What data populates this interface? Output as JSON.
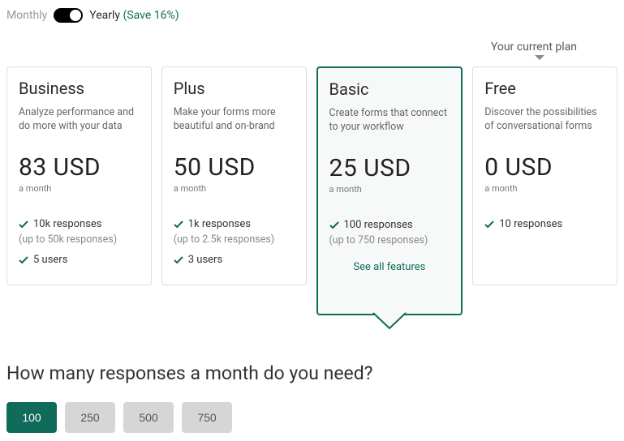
{
  "billing": {
    "monthly_label": "Monthly",
    "yearly_label": "Yearly",
    "save_label": "(Save 16%)"
  },
  "current_plan_label": "Your current plan",
  "plans": [
    {
      "name": "Business",
      "desc": "Analyze performance and do more with your data",
      "price": "83 USD",
      "period": "a month",
      "feat1": "10k responses",
      "feat1_sub": "(up to 50k responses)",
      "feat2": "5 users"
    },
    {
      "name": "Plus",
      "desc": "Make your forms more beautiful and on-brand",
      "price": "50 USD",
      "period": "a month",
      "feat1": "1k responses",
      "feat1_sub": "(up to 2.5k responses)",
      "feat2": "3 users"
    },
    {
      "name": "Basic",
      "desc": "Create forms that connect to your workflow",
      "price": "25 USD",
      "period": "a month",
      "feat1": "100 responses",
      "feat1_sub": "(up to 750 responses)",
      "see_all": "See all features"
    },
    {
      "name": "Free",
      "desc": "Discover the possibilities of conversational forms",
      "price": "0 USD",
      "period": "a month",
      "feat1": "10 responses"
    }
  ],
  "responses": {
    "heading": "How many responses a month do you need?",
    "options": [
      "100",
      "250",
      "500",
      "750"
    ],
    "selected": "100"
  }
}
